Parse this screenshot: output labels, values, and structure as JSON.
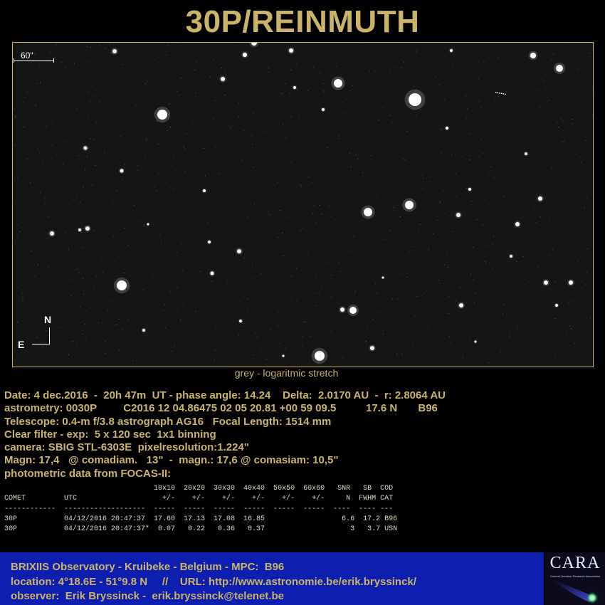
{
  "title": "30P/REINMUTH",
  "image": {
    "scale_label": "60\"",
    "north_label": "N",
    "east_label": "E",
    "caption": "grey - logaritmic stretch"
  },
  "info_lines": [
    "Date: 4 dec.2016  -  20h 47m  UT - phase angle: 14.24    Delta:  2.0170 AU  -  r: 2.8064 AU",
    "astrometry: 0030P         C2016 12 04.86475 02 05 20.81 +00 59 09.5          17.6 N       B96",
    "Telescope: 0.4-m f/3.8 astrograph AG16   Focal Length: 1514 mm",
    "Clear filter - exp:  5 x 120 sec  1x1 binning",
    "camera: SBIG STL-6303E  pixelresolution:1.224\"",
    "Magn: 17,4   @ comadiam.   13\"  -  magn.: 17,6 @ comasiam: 10,5\"",
    "photometric data from FOCAS-II:"
  ],
  "photometry_lines": [
    "                                   10x10  20x20  30x30  40x40  50x50  60x60   SNR   SB  COD",
    "COMET         UTC                    +/-    +/-    +/-    +/-    +/-    +/-     N  FWHM CAT",
    "------------  -------------------  -----  -----  -----  -----  -----  -----  ----  ---- ---",
    "30P           04/12/2016 20:47:37  17.60  17.13  17.08  16.85                  6.6  17.2 B96",
    "30P           04/12/2016 20:47:37*  0.07   0.22   0.36   0.37                    3   3.7 USN"
  ],
  "footer": {
    "line1": "BRIXIIS Observatory - Kruibeke - Belgium - MPC:  B96",
    "line2": "location: 4°18.6E - 51°9.8 N     //    URL: http://www.astronomie.be/erik.bryssinck/",
    "line3": "observer:  Erik Bryssinck -  erik.bryssinck@telenet.be"
  },
  "logo": {
    "name": "CARA",
    "subtitle": "Comets' Amateur Research Association"
  },
  "colors": {
    "accent": "#c9b46a",
    "footer_bg": "#0e1fb0",
    "background": "#000000"
  }
}
